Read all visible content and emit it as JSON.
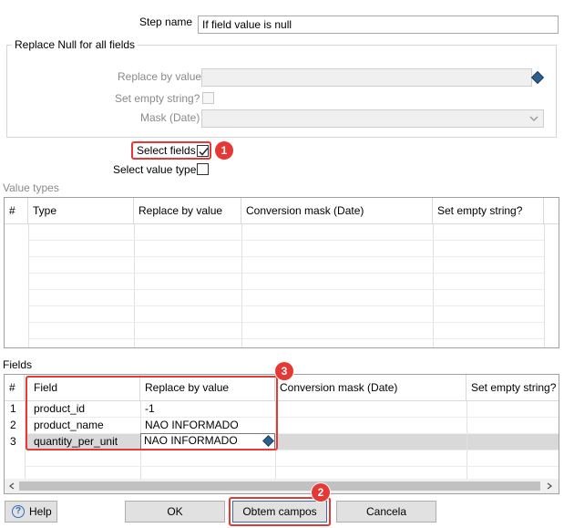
{
  "step_name": {
    "label": "Step name",
    "value": "If field value is null"
  },
  "replace_null_group": {
    "title": "Replace Null for all fields",
    "replace_by_value_label": "Replace by value",
    "replace_by_value_value": "",
    "set_empty_string_label": "Set empty string?",
    "mask_label": "Mask (Date)",
    "mask_value": ""
  },
  "select_fields": {
    "label": "Select fields",
    "checked": true
  },
  "select_value_type": {
    "label": "Select value type",
    "checked": false
  },
  "value_types": {
    "title": "Value types",
    "columns": [
      "#",
      "Type",
      "Replace by value",
      "Conversion mask (Date)",
      "Set empty string?"
    ]
  },
  "fields": {
    "title": "Fields",
    "columns": [
      "#",
      "Field",
      "Replace by value",
      "Conversion mask (Date)",
      "Set empty string?"
    ],
    "rows": [
      {
        "num": "1",
        "field": "product_id",
        "replace": "-1"
      },
      {
        "num": "2",
        "field": "product_name",
        "replace": "NAO INFORMADO"
      },
      {
        "num": "3",
        "field": "quantity_per_unit",
        "replace": "NAO INFORMADO"
      }
    ]
  },
  "buttons": {
    "help": "Help",
    "ok": "OK",
    "get_fields": "Obtem campos",
    "cancel": "Cancela"
  },
  "badges": [
    "1",
    "2",
    "3"
  ],
  "colors": {
    "annotation_red": "#e53935",
    "selected_row": "#d9d9d9"
  },
  "icons": [
    "variable-diamond-icon",
    "dropdown-chevron-icon",
    "help-circle-icon",
    "scroll-left-icon",
    "scroll-right-icon",
    "checkmark-icon"
  ]
}
